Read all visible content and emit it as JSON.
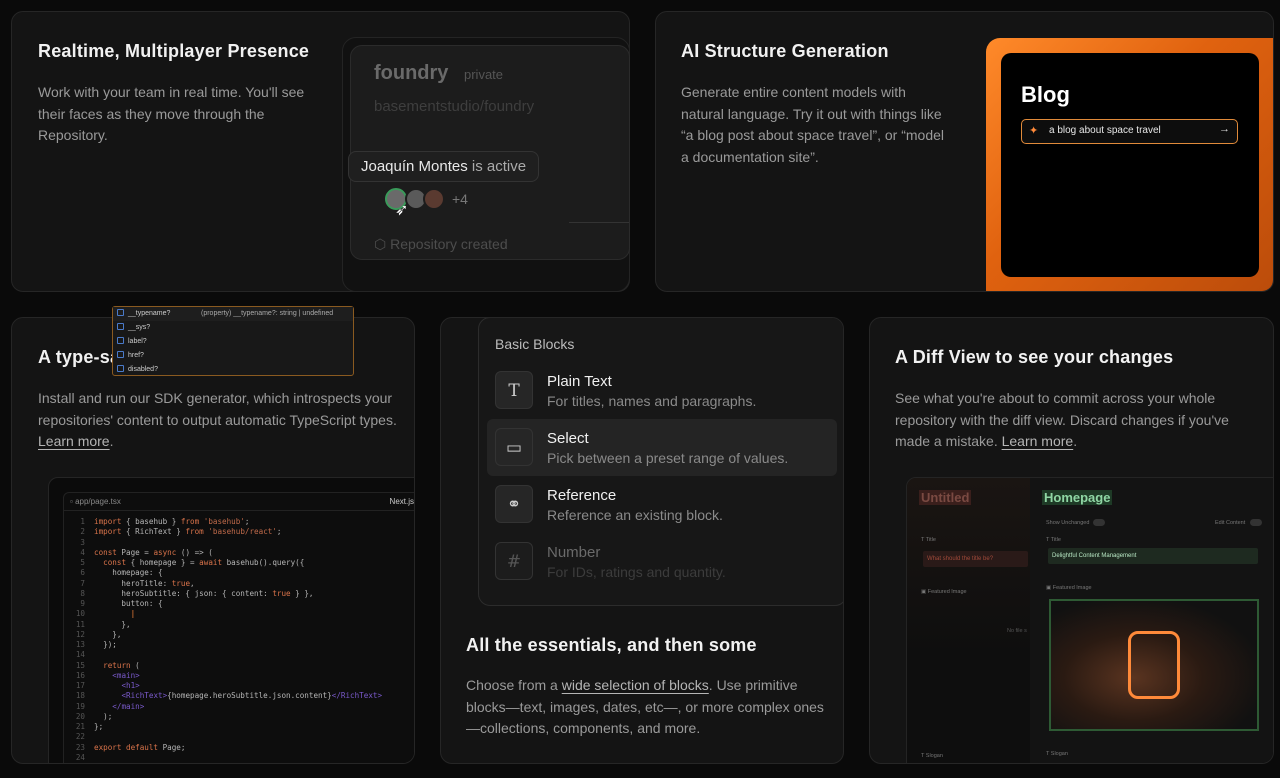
{
  "presence": {
    "title": "Realtime, Multiplayer Presence",
    "desc": "Work with your team in real time. You'll see their faces as they move through the Repository.",
    "repo_name": "foundry",
    "repo_visibility": "private",
    "repo_path": "basementstudio/foundry",
    "tooltip_user": "Joaquín Montes",
    "tooltip_status": " is active",
    "more_count": "+4",
    "event": "Repository created"
  },
  "ai": {
    "title": "AI Structure Generation",
    "desc": "Generate entire content models with natural language. Try it out with things like “a blog post about space travel”, or “model a documentation site”.",
    "demo_title": "Blog",
    "prompt_value": "a blog about space travel"
  },
  "sdk": {
    "title": "A type-safe SDK",
    "desc": "Install and run our SDK generator, which introspects your repositories' content to output automatic TypeScript types. ",
    "link": "Learn more",
    "file": "app/page.tsx",
    "framework": "Next.js",
    "suggestions": [
      {
        "label": "__typename?",
        "detail": "(property)  __typename?:  string | undefined"
      },
      {
        "label": "__sys?",
        "detail": ""
      },
      {
        "label": "label?",
        "detail": ""
      },
      {
        "label": "href?",
        "detail": ""
      },
      {
        "label": "disabled?",
        "detail": ""
      }
    ]
  },
  "blocks": {
    "heading": "Basic Blocks",
    "items": [
      {
        "icon": "T",
        "title": "Plain Text",
        "desc": "For titles, names and paragraphs."
      },
      {
        "icon": "▭",
        "title": "Select",
        "desc": "Pick between a preset range of values."
      },
      {
        "icon": "⚭",
        "title": "Reference",
        "desc": "Reference an existing block."
      },
      {
        "icon": "#",
        "title": "Number",
        "desc": "For IDs, ratings and quantity."
      }
    ],
    "title": "All the essentials, and then some",
    "desc_pre": "Choose from a ",
    "link": "wide selection of blocks",
    "desc_post": ". Use primitive blocks—text, images, dates, etc—, or more complex ones—collections, components, and more."
  },
  "diff": {
    "title": "A Diff View to see your changes",
    "desc": "See what you're about to commit across your whole repository with the diff view. Discard changes if you've made a mistake. ",
    "link": "Learn more",
    "left_title": "Untitled",
    "right_title": "Homepage",
    "show_unchanged": "Show Unchanged",
    "edit_content": "Edit Content",
    "field_title": "Title",
    "left_value": "What should the title be?",
    "right_value": "Delightful Content Management",
    "featured_image": "Featured Image",
    "no_file": "No file s",
    "slogan": "Slogan"
  }
}
